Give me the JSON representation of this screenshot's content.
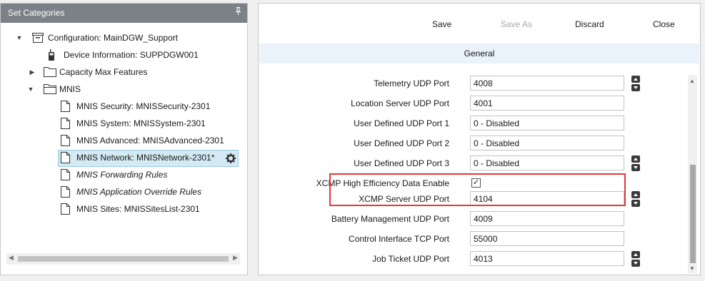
{
  "left_panel": {
    "title": "Set Categories",
    "pin": "📌"
  },
  "tree": [
    {
      "label": "Configuration: MainDGW_Support",
      "icon": "configuration-icon",
      "expander": "▼",
      "italic": false
    },
    {
      "label": "Device Information: SUPPDGW001",
      "icon": "device-icon",
      "expander": "",
      "italic": false
    },
    {
      "label": "Capacity Max Features",
      "icon": "folder-icon",
      "expander": "▶",
      "italic": false
    },
    {
      "label": "MNIS",
      "icon": "folder-open-icon",
      "expander": "▼",
      "italic": false
    },
    {
      "label": "MNIS Security: MNISSecurity-2301",
      "icon": "document-icon",
      "expander": "",
      "italic": false
    },
    {
      "label": "MNIS System: MNISSystem-2301",
      "icon": "document-icon",
      "expander": "",
      "italic": false
    },
    {
      "label": "MNIS Advanced: MNISAdvanced-2301",
      "icon": "document-icon",
      "expander": "",
      "italic": false
    },
    {
      "label": "MNIS Network: MNISNetwork-2301*",
      "icon": "document-icon",
      "expander": "",
      "italic": false,
      "selected": true
    },
    {
      "label": "MNIS Forwarding Rules",
      "icon": "document-icon",
      "expander": "",
      "italic": true
    },
    {
      "label": "MNIS Application Override Rules",
      "icon": "document-icon",
      "expander": "",
      "italic": true
    },
    {
      "label": "MNIS Sites: MNISSitesList-2301",
      "icon": "document-icon",
      "expander": "",
      "italic": false
    }
  ],
  "toolbar": {
    "save": "Save",
    "save_as": "Save As",
    "discard": "Discard",
    "close": "Close"
  },
  "section": {
    "title": "General"
  },
  "form": [
    {
      "label": "Telemetry UDP Port",
      "value": "4008",
      "type": "spinner"
    },
    {
      "label": "Location Server UDP Port",
      "value": "4001",
      "type": "text"
    },
    {
      "label": "User Defined UDP Port 1",
      "value": "0 - Disabled",
      "type": "text"
    },
    {
      "label": "User Defined UDP Port 2",
      "value": "0 - Disabled",
      "type": "text"
    },
    {
      "label": "User Defined UDP Port 3",
      "value": "0 - Disabled",
      "type": "spinner"
    },
    {
      "label": "XCMP High Efficiency Data Enable",
      "checked": true,
      "type": "checkbox"
    },
    {
      "label": "XCMP Server UDP Port",
      "value": "4104",
      "type": "spinner"
    },
    {
      "label": "Battery Management UDP Port",
      "value": "4009",
      "type": "text"
    },
    {
      "label": "Control Interface TCP Port",
      "value": "55000",
      "type": "text"
    },
    {
      "label": "Job Ticket UDP Port",
      "value": "4013",
      "type": "spinner"
    }
  ],
  "colors": {
    "highlight": "#e0393b",
    "selected_row": "#d3e9f3",
    "section_header": "#eaf2fb",
    "panel_title": "#7c8188"
  }
}
